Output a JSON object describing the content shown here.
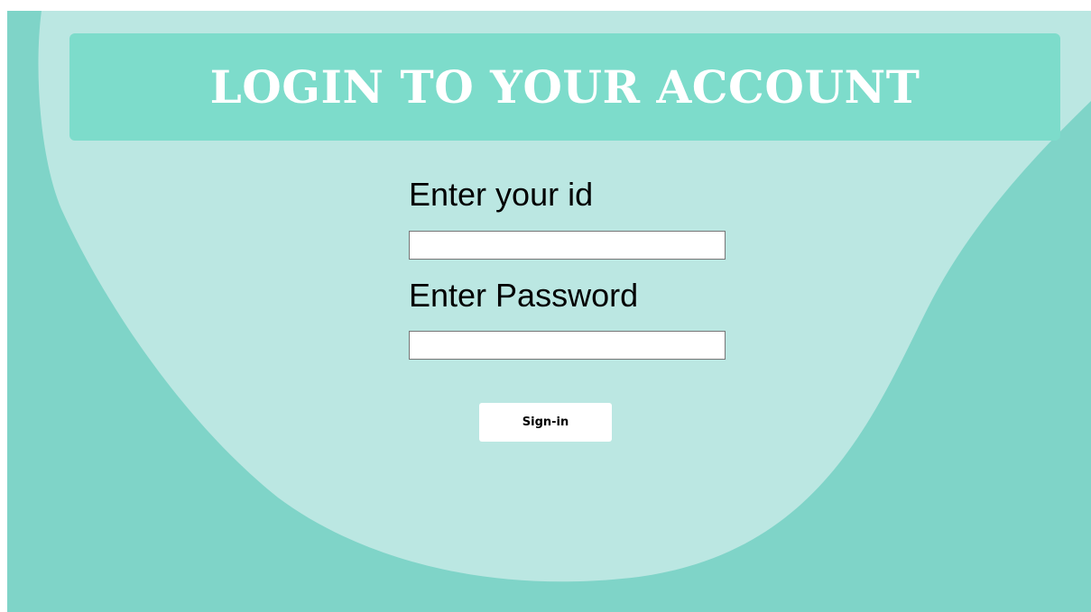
{
  "header": {
    "title": "LOGIN TO YOUR ACCOUNT"
  },
  "form": {
    "id_label": "Enter your id",
    "id_value": "",
    "password_label": "Enter Password",
    "password_value": "",
    "signin_label": "Sign-in"
  },
  "colors": {
    "background": "#7fd4c8",
    "blob": "#bbe7e2",
    "header_bar": "#7ddccb",
    "title_text": "#ffffff",
    "button_bg": "#ffffff"
  }
}
